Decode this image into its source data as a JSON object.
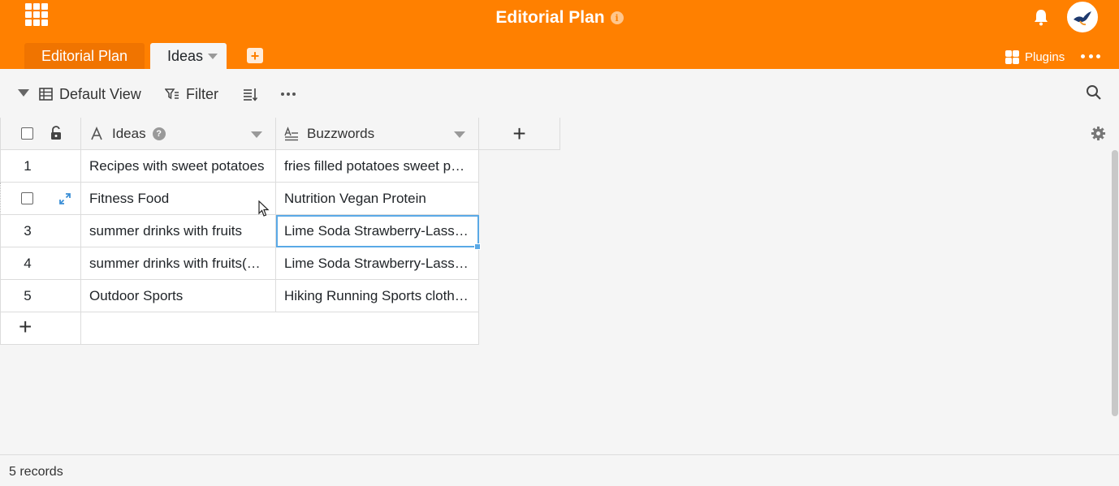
{
  "header": {
    "title": "Editorial Plan",
    "title_info_icon": "info-icon",
    "bg_color": "#ff8000",
    "tabs": [
      {
        "label": "Editorial Plan",
        "active": false
      },
      {
        "label": "Ideas",
        "active": true
      }
    ],
    "plugins_label": "Plugins"
  },
  "toolbar": {
    "view_label": "Default View",
    "filter_label": "Filter"
  },
  "table": {
    "columns": [
      {
        "name": "Ideas",
        "icon": "text-column-icon"
      },
      {
        "name": "Buzzwords",
        "icon": "long-text-column-icon"
      }
    ],
    "add_column_label": "+",
    "rows": [
      {
        "index": "1",
        "ideas": "Recipes with sweet potatoes",
        "buzzwords": "fries filled potatoes sweet potatoes"
      },
      {
        "index": "2",
        "ideas": "Fitness Food",
        "buzzwords": "Nutrition Vegan Protein"
      },
      {
        "index": "3",
        "ideas": "summer drinks with fruits",
        "buzzwords": "Lime Soda Strawberry-Lassi Smoothie"
      },
      {
        "index": "4",
        "ideas": "summer drinks with fruits(…",
        "buzzwords": "Lime Soda Strawberry-Lassi Smoothie"
      },
      {
        "index": "5",
        "ideas": "Outdoor Sports",
        "buzzwords": "Hiking Running Sports clothing"
      }
    ],
    "add_row_label": "+",
    "selection_color": "#5aa9e6"
  },
  "footer": {
    "records_label": "5 records"
  }
}
